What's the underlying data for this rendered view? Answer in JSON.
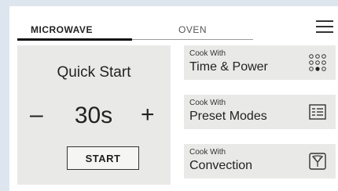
{
  "tabs": {
    "microwave": "MICROWAVE",
    "oven": "OVEN",
    "active": "microwave"
  },
  "quick_start": {
    "title": "Quick Start",
    "minus": "–",
    "time": "30s",
    "plus": "+",
    "start": "START"
  },
  "cards": [
    {
      "small": "Cook With",
      "label": "Time & Power",
      "icon": "power-level-dots-icon"
    },
    {
      "small": "Cook With",
      "label": "Preset Modes",
      "icon": "preset-list-icon"
    },
    {
      "small": "Cook With",
      "label": "Convection",
      "icon": "convection-fan-icon"
    }
  ],
  "colors": {
    "background": "#dde6ef",
    "panel": "#ffffff",
    "tile": "#e9eae8",
    "text": "#1e1e1e"
  }
}
